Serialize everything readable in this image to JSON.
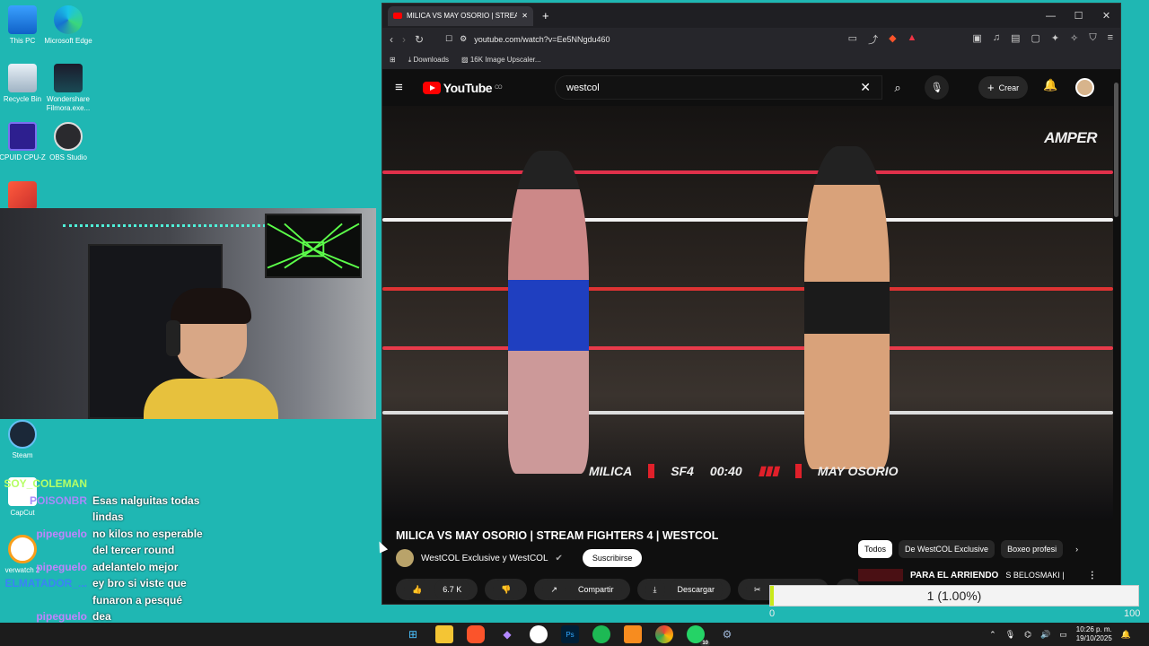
{
  "desktop": {
    "icons": [
      {
        "label": "This PC"
      },
      {
        "label": "Microsoft Edge"
      },
      {
        "label": "Recycle Bin"
      },
      {
        "label": "Wondershare Filmora.exe..."
      },
      {
        "label": "CPUID CPU-Z"
      },
      {
        "label": "OBS Studio"
      },
      {
        "label": "Steam"
      },
      {
        "label": "CapCut"
      },
      {
        "label": "verwatch 2"
      }
    ]
  },
  "chat": {
    "messages": [
      {
        "user": "SOY_COLEMAN",
        "user_color": "#b6ff66",
        "text": ""
      },
      {
        "user": "POISONBR",
        "user_color": "#a78bfa",
        "text": "Esas nalguitas todas lindas"
      },
      {
        "user": "pipeguelo",
        "user_color": "#c084fc",
        "text": "no kilos no esperable del tercer round"
      },
      {
        "user": "pipeguelo",
        "user_color": "#c084fc",
        "text": "adelantelo mejor"
      },
      {
        "user": "ELMATADOR_...",
        "user_color": "#3b82f6",
        "text": "ey bro si viste que funaron a pesqué"
      },
      {
        "user": "pipeguelo",
        "user_color": "#c084fc",
        "text": "dea"
      }
    ]
  },
  "browser": {
    "tab_title": "MILICA VS MAY OSORIO | STREA",
    "url": "youtube.com/watch?v=Ee5NNgdu460",
    "bookmarks": [
      "Downloads",
      "16K Image Upscaler..."
    ],
    "window_buttons": [
      "—",
      "☐",
      "✕"
    ]
  },
  "youtube": {
    "logo": "YouTube",
    "region": "CO",
    "search_value": "westcol",
    "create_label": "Crear",
    "video": {
      "watermark": "AMPER",
      "scoreboard": {
        "left": "MILICA",
        "center_logo": "SF4",
        "time": "00:40",
        "right": "MAY OSORIO"
      }
    },
    "title": "MILICA VS MAY OSORIO | STREAM FIGHTERS 4 | WESTCOL",
    "channel": "WestCOL Exclusive y WestCOL",
    "subscribe": "Suscribirse",
    "actions": {
      "likes": "6.7 K",
      "share": "Compartir",
      "download": "Descargar",
      "clip": "Recortar",
      "more": "⋯"
    },
    "chips": [
      "Todos",
      "De WestCOL Exclusive",
      "Boxeo profesi"
    ],
    "recommended_title": "PARA EL ARRIENDO",
    "recommended_sub": "S BELOSMAKI |"
  },
  "progress": {
    "label": "1 (1.00%)",
    "fraction": 0.01,
    "min": "0",
    "max": "100"
  },
  "taskbar": {
    "time": "10:26 p. m.",
    "date": "19/10/2025",
    "whatsapp_badge": "10"
  },
  "colors": {
    "accent_teal": "#1fb7b3",
    "youtube_red": "#ff0000",
    "progress_fill": "#c9e91a"
  }
}
